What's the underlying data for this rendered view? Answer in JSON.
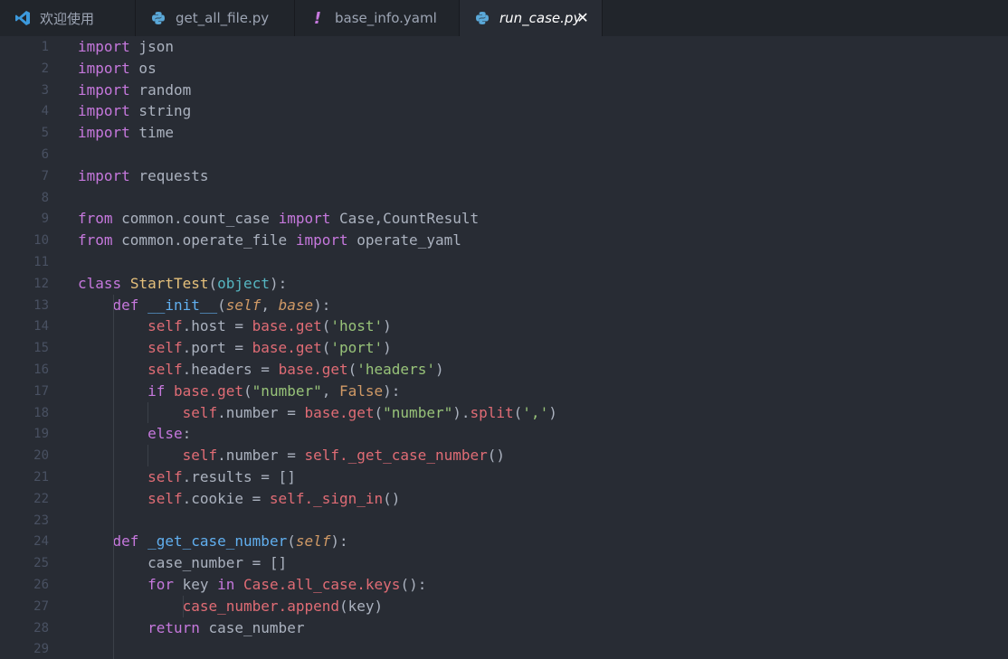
{
  "tabs": [
    {
      "label": "欢迎使用",
      "icon": "vscode-icon",
      "active": false
    },
    {
      "label": "get_all_file.py",
      "icon": "python-icon",
      "active": false
    },
    {
      "label": "base_info.yaml",
      "icon": "yaml-exclamation-icon",
      "active": false
    },
    {
      "label": "run_case.py",
      "icon": "python-icon",
      "active": true
    }
  ],
  "tab_close_glyph": "✕",
  "colors": {
    "background": "#282c34",
    "tabbar": "#21252b",
    "keyword": "#c678dd",
    "function": "#61afef",
    "class": "#e5c07b",
    "string": "#98c379",
    "self": "#e06c75",
    "param": "#d19a66",
    "builtin": "#56b6c2",
    "line_number": "#495162",
    "text": "#abb2bf"
  },
  "line_numbers": [
    "1",
    "2",
    "3",
    "4",
    "5",
    "6",
    "7",
    "8",
    "9",
    "10",
    "11",
    "12",
    "13",
    "14",
    "15",
    "16",
    "17",
    "18",
    "19",
    "20",
    "21",
    "22",
    "23",
    "24",
    "25",
    "26",
    "27",
    "28",
    "29"
  ],
  "code": [
    [
      {
        "t": "import",
        "c": "kw"
      },
      {
        "t": " json",
        "c": "plain"
      }
    ],
    [
      {
        "t": "import",
        "c": "kw"
      },
      {
        "t": " os",
        "c": "plain"
      }
    ],
    [
      {
        "t": "import",
        "c": "kw"
      },
      {
        "t": " random",
        "c": "plain"
      }
    ],
    [
      {
        "t": "import",
        "c": "kw"
      },
      {
        "t": " string",
        "c": "plain"
      }
    ],
    [
      {
        "t": "import",
        "c": "kw"
      },
      {
        "t": " time",
        "c": "plain"
      }
    ],
    [],
    [
      {
        "t": "import",
        "c": "kw"
      },
      {
        "t": " requests",
        "c": "plain"
      }
    ],
    [],
    [
      {
        "t": "from",
        "c": "kw"
      },
      {
        "t": " common.count_case ",
        "c": "plain"
      },
      {
        "t": "import",
        "c": "kw"
      },
      {
        "t": " Case,CountResult",
        "c": "plain"
      }
    ],
    [
      {
        "t": "from",
        "c": "kw"
      },
      {
        "t": " common.operate_file ",
        "c": "plain"
      },
      {
        "t": "import",
        "c": "kw"
      },
      {
        "t": " operate_yaml",
        "c": "plain"
      }
    ],
    [],
    [
      {
        "t": "class",
        "c": "kw"
      },
      {
        "t": " ",
        "c": "plain"
      },
      {
        "t": "StartTest",
        "c": "cls"
      },
      {
        "t": "(",
        "c": "plain"
      },
      {
        "t": "object",
        "c": "builtin"
      },
      {
        "t": "):",
        "c": "plain"
      }
    ],
    [
      {
        "t": "    ",
        "c": "plain"
      },
      {
        "t": "def",
        "c": "kw"
      },
      {
        "t": " ",
        "c": "plain"
      },
      {
        "t": "__init__",
        "c": "fn"
      },
      {
        "t": "(",
        "c": "plain"
      },
      {
        "t": "self",
        "c": "param"
      },
      {
        "t": ", ",
        "c": "plain"
      },
      {
        "t": "base",
        "c": "param"
      },
      {
        "t": "):",
        "c": "plain"
      }
    ],
    [
      {
        "t": "        ",
        "c": "plain"
      },
      {
        "t": "self",
        "c": "self"
      },
      {
        "t": ".host = ",
        "c": "plain"
      },
      {
        "t": "base.get",
        "c": "meth"
      },
      {
        "t": "(",
        "c": "plain"
      },
      {
        "t": "'host'",
        "c": "str"
      },
      {
        "t": ")",
        "c": "plain"
      }
    ],
    [
      {
        "t": "        ",
        "c": "plain"
      },
      {
        "t": "self",
        "c": "self"
      },
      {
        "t": ".port = ",
        "c": "plain"
      },
      {
        "t": "base.get",
        "c": "meth"
      },
      {
        "t": "(",
        "c": "plain"
      },
      {
        "t": "'port'",
        "c": "str"
      },
      {
        "t": ")",
        "c": "plain"
      }
    ],
    [
      {
        "t": "        ",
        "c": "plain"
      },
      {
        "t": "self",
        "c": "self"
      },
      {
        "t": ".headers = ",
        "c": "plain"
      },
      {
        "t": "base.get",
        "c": "meth"
      },
      {
        "t": "(",
        "c": "plain"
      },
      {
        "t": "'headers'",
        "c": "str"
      },
      {
        "t": ")",
        "c": "plain"
      }
    ],
    [
      {
        "t": "        ",
        "c": "plain"
      },
      {
        "t": "if",
        "c": "kw"
      },
      {
        "t": " ",
        "c": "plain"
      },
      {
        "t": "base.get",
        "c": "meth"
      },
      {
        "t": "(",
        "c": "plain"
      },
      {
        "t": "\"number\"",
        "c": "str"
      },
      {
        "t": ", ",
        "c": "plain"
      },
      {
        "t": "False",
        "c": "bool"
      },
      {
        "t": "):",
        "c": "plain"
      }
    ],
    [
      {
        "t": "            ",
        "c": "plain"
      },
      {
        "t": "self",
        "c": "self"
      },
      {
        "t": ".number = ",
        "c": "plain"
      },
      {
        "t": "base.get",
        "c": "meth"
      },
      {
        "t": "(",
        "c": "plain"
      },
      {
        "t": "\"number\"",
        "c": "str"
      },
      {
        "t": ").",
        "c": "plain"
      },
      {
        "t": "split",
        "c": "meth"
      },
      {
        "t": "(",
        "c": "plain"
      },
      {
        "t": "','",
        "c": "str"
      },
      {
        "t": ")",
        "c": "plain"
      }
    ],
    [
      {
        "t": "        ",
        "c": "plain"
      },
      {
        "t": "else",
        "c": "kw"
      },
      {
        "t": ":",
        "c": "plain"
      }
    ],
    [
      {
        "t": "            ",
        "c": "plain"
      },
      {
        "t": "self",
        "c": "self"
      },
      {
        "t": ".number = ",
        "c": "plain"
      },
      {
        "t": "self._get_case_number",
        "c": "meth"
      },
      {
        "t": "()",
        "c": "plain"
      }
    ],
    [
      {
        "t": "        ",
        "c": "plain"
      },
      {
        "t": "self",
        "c": "self"
      },
      {
        "t": ".results = []",
        "c": "plain"
      }
    ],
    [
      {
        "t": "        ",
        "c": "plain"
      },
      {
        "t": "self",
        "c": "self"
      },
      {
        "t": ".cookie = ",
        "c": "plain"
      },
      {
        "t": "self._sign_in",
        "c": "meth"
      },
      {
        "t": "()",
        "c": "plain"
      }
    ],
    [],
    [
      {
        "t": "    ",
        "c": "plain"
      },
      {
        "t": "def",
        "c": "kw"
      },
      {
        "t": " ",
        "c": "plain"
      },
      {
        "t": "_get_case_number",
        "c": "fn"
      },
      {
        "t": "(",
        "c": "plain"
      },
      {
        "t": "self",
        "c": "param"
      },
      {
        "t": "):",
        "c": "plain"
      }
    ],
    [
      {
        "t": "        case_number = []",
        "c": "plain"
      }
    ],
    [
      {
        "t": "        ",
        "c": "plain"
      },
      {
        "t": "for",
        "c": "kw"
      },
      {
        "t": " key ",
        "c": "plain"
      },
      {
        "t": "in",
        "c": "kw"
      },
      {
        "t": " ",
        "c": "plain"
      },
      {
        "t": "Case.all_case.keys",
        "c": "meth"
      },
      {
        "t": "():",
        "c": "plain"
      }
    ],
    [
      {
        "t": "            ",
        "c": "plain"
      },
      {
        "t": "case_number.append",
        "c": "meth"
      },
      {
        "t": "(key)",
        "c": "plain"
      }
    ],
    [
      {
        "t": "        ",
        "c": "plain"
      },
      {
        "t": "return",
        "c": "kw"
      },
      {
        "t": " case_number",
        "c": "plain"
      }
    ],
    []
  ]
}
